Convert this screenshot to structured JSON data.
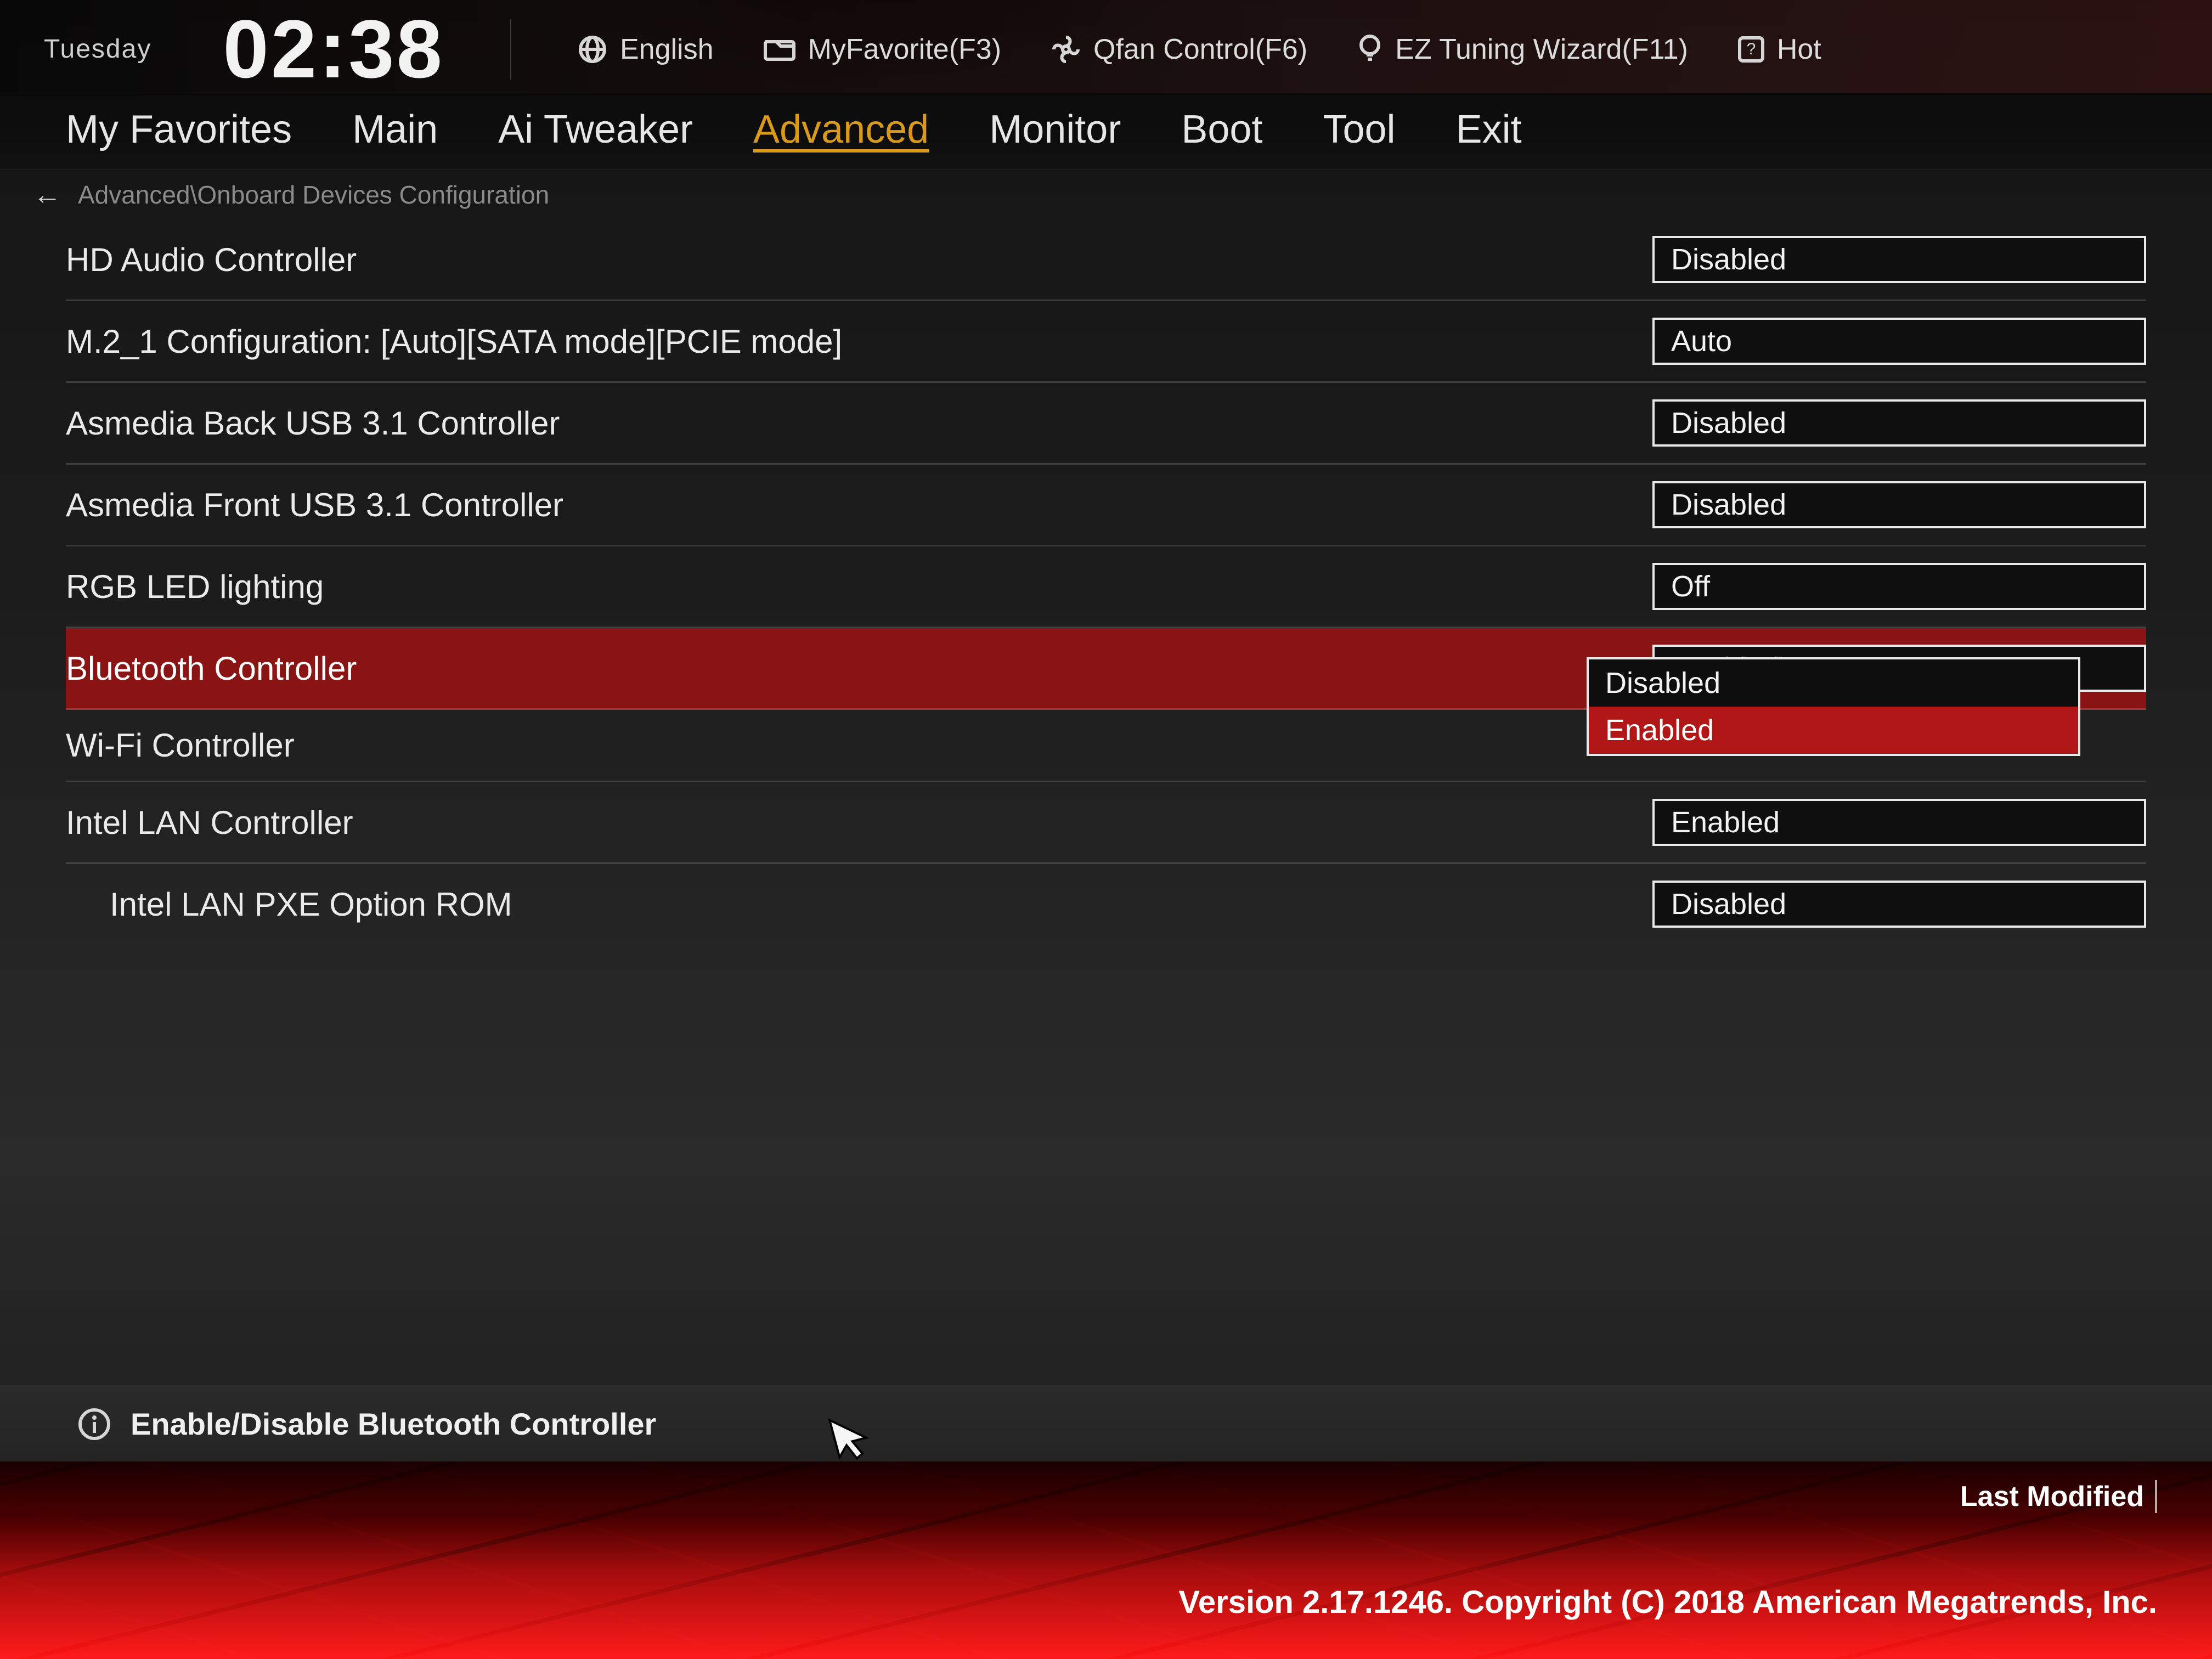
{
  "header": {
    "day": "Tuesday",
    "time": "02:38",
    "items": {
      "language": "English",
      "favorites": "MyFavorite(F3)",
      "qfan": "Qfan Control(F6)",
      "ez": "EZ Tuning Wizard(F11)",
      "hotkeys": "Hot"
    }
  },
  "tabs": {
    "my_favorites": "My Favorites",
    "main": "Main",
    "ai_tweaker": "Ai Tweaker",
    "advanced": "Advanced",
    "monitor": "Monitor",
    "boot": "Boot",
    "tool": "Tool",
    "exit": "Exit",
    "active": "advanced"
  },
  "breadcrumb": {
    "path": "Advanced\\Onboard Devices Configuration"
  },
  "settings": [
    {
      "key": "hd_audio",
      "label": "HD Audio Controller",
      "value": "Disabled"
    },
    {
      "key": "m2_1",
      "label": "M.2_1 Configuration: [Auto][SATA mode][PCIE mode]",
      "value": "Auto"
    },
    {
      "key": "asmedia_back",
      "label": "Asmedia Back USB 3.1 Controller",
      "value": "Disabled"
    },
    {
      "key": "asmedia_front",
      "label": "Asmedia Front USB 3.1 Controller",
      "value": "Disabled"
    },
    {
      "key": "rgb_led",
      "label": "RGB LED lighting",
      "value": "Off"
    },
    {
      "key": "bluetooth",
      "label": "Bluetooth Controller",
      "value": "Enabled",
      "selected": true
    },
    {
      "key": "wifi",
      "label": "Wi-Fi Controller",
      "value": ""
    },
    {
      "key": "intel_lan",
      "label": "Intel LAN Controller",
      "value": "Enabled"
    },
    {
      "key": "intel_lan_pxe",
      "label": "Intel LAN PXE Option ROM",
      "value": "Disabled",
      "indent": true
    }
  ],
  "dropdown": {
    "for": "bluetooth",
    "options": [
      "Disabled",
      "Enabled"
    ],
    "selected_index": 1
  },
  "help": {
    "text": "Enable/Disable Bluetooth Controller"
  },
  "footer": {
    "last_modified": "Last Modified",
    "copyright": "Version 2.17.1246. Copyright (C) 2018 American Megatrends, Inc."
  }
}
